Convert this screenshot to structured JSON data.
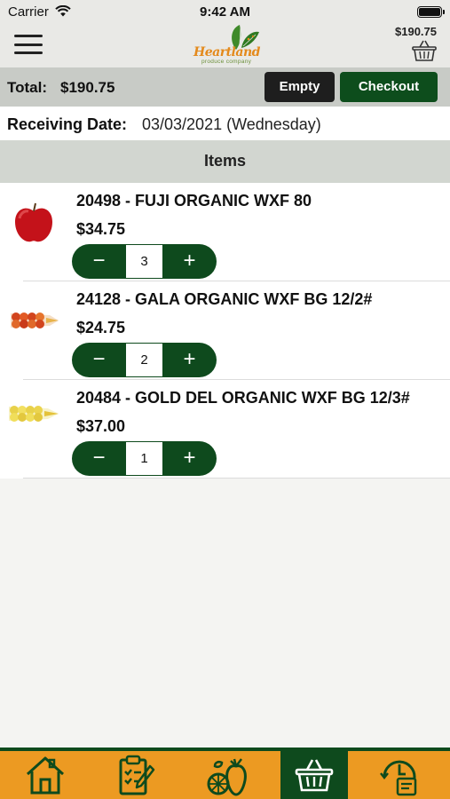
{
  "status": {
    "carrier": "Carrier",
    "time": "9:42 AM"
  },
  "header": {
    "brand_main": "Heartland",
    "brand_sub": "produce company",
    "cart_total": "$190.75"
  },
  "totals": {
    "label": "Total:",
    "value": "$190.75",
    "empty_label": "Empty",
    "checkout_label": "Checkout"
  },
  "receiving": {
    "label": "Receiving Date:",
    "value": "03/03/2021 (Wednesday)"
  },
  "items_header": "Items",
  "items": [
    {
      "title": "20498 - FUJI ORGANIC WXF 80",
      "price": "$34.75",
      "qty": "3",
      "minus": "−",
      "plus": "+",
      "image": "red-apple"
    },
    {
      "title": "24128 - GALA ORGANIC WXF BG 12/2#",
      "price": "$24.75",
      "qty": "2",
      "minus": "−",
      "plus": "+",
      "image": "apple-bag-red"
    },
    {
      "title": "20484 - GOLD DEL ORGANIC WXF BG 12/3#",
      "price": "$37.00",
      "qty": "1",
      "minus": "−",
      "plus": "+",
      "image": "apple-bag-yellow"
    }
  ],
  "tabs": [
    {
      "name": "home",
      "icon": "home-icon"
    },
    {
      "name": "order-list",
      "icon": "clipboard-icon"
    },
    {
      "name": "produce",
      "icon": "produce-icon"
    },
    {
      "name": "cart",
      "icon": "basket-icon",
      "active": true
    },
    {
      "name": "order-history",
      "icon": "clock-document-icon"
    }
  ],
  "colors": {
    "brand_green": "#0e4a1d",
    "brand_orange": "#ec9a22",
    "total_bar": "#c8cbc6"
  }
}
